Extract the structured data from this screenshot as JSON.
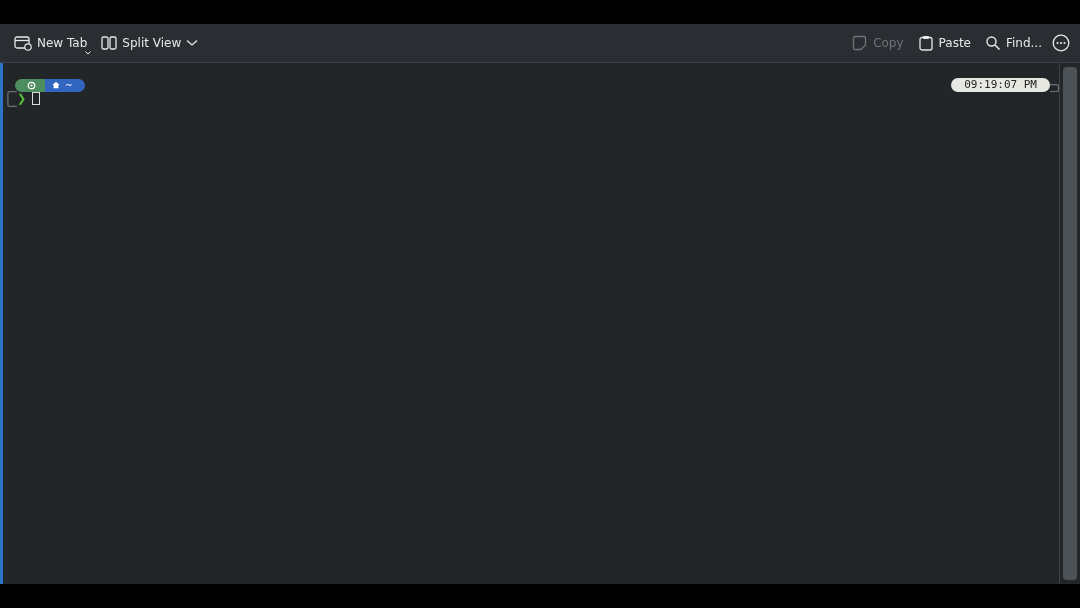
{
  "toolbar": {
    "left": [
      {
        "kind": "new-tab",
        "label": "New Tab",
        "disabled": false
      },
      {
        "kind": "split",
        "label": "Split View",
        "disabled": false
      }
    ],
    "right": [
      {
        "kind": "copy",
        "label": "Copy",
        "disabled": true
      },
      {
        "kind": "paste",
        "label": "Paste",
        "disabled": false
      },
      {
        "kind": "find",
        "label": "Find...",
        "disabled": false
      }
    ]
  },
  "terminal": {
    "prompt": {
      "path": "~",
      "symbol": "❯",
      "time": "09:19:07 PM"
    }
  }
}
